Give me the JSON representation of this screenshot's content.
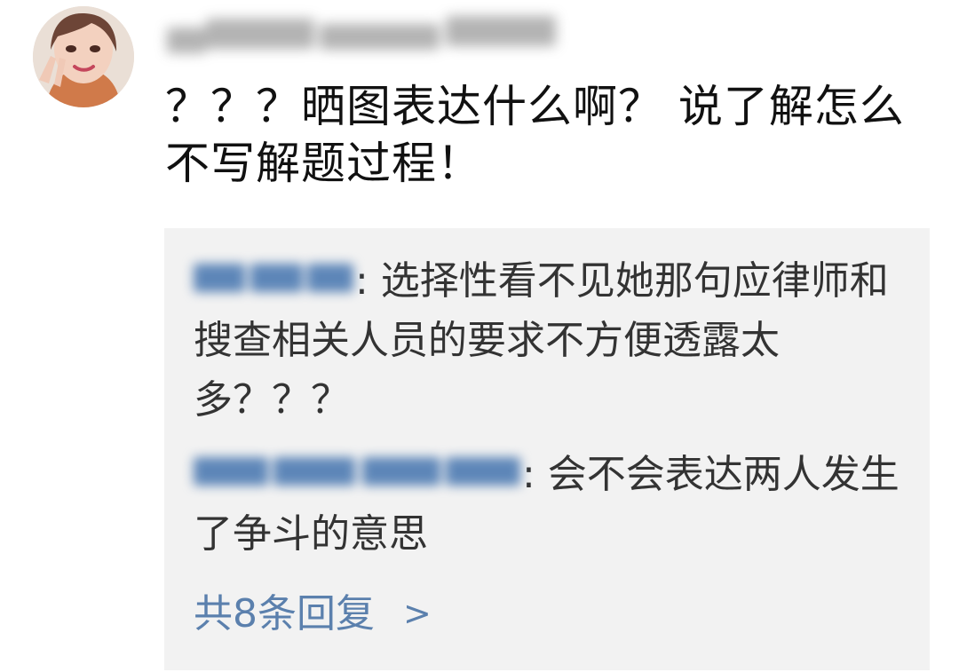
{
  "comment": {
    "text": "？？？晒图表达什么啊？ 说了解怎么不写解题过程！"
  },
  "replies": [
    {
      "text": ": 选择性看不见她那句应律师和搜查相关人员的要求不方便透露太多？？？"
    },
    {
      "text": ": 会不会表达两人发生了争斗的意思"
    }
  ],
  "more_replies": {
    "label": "共8条回复",
    "chevron": ">"
  },
  "colors": {
    "link_blue": "#5b80ad",
    "reply_background": "#f2f2f2",
    "text": "#111111"
  },
  "icons": {
    "avatar": "profile-photo",
    "more": "chevron-right-icon"
  }
}
